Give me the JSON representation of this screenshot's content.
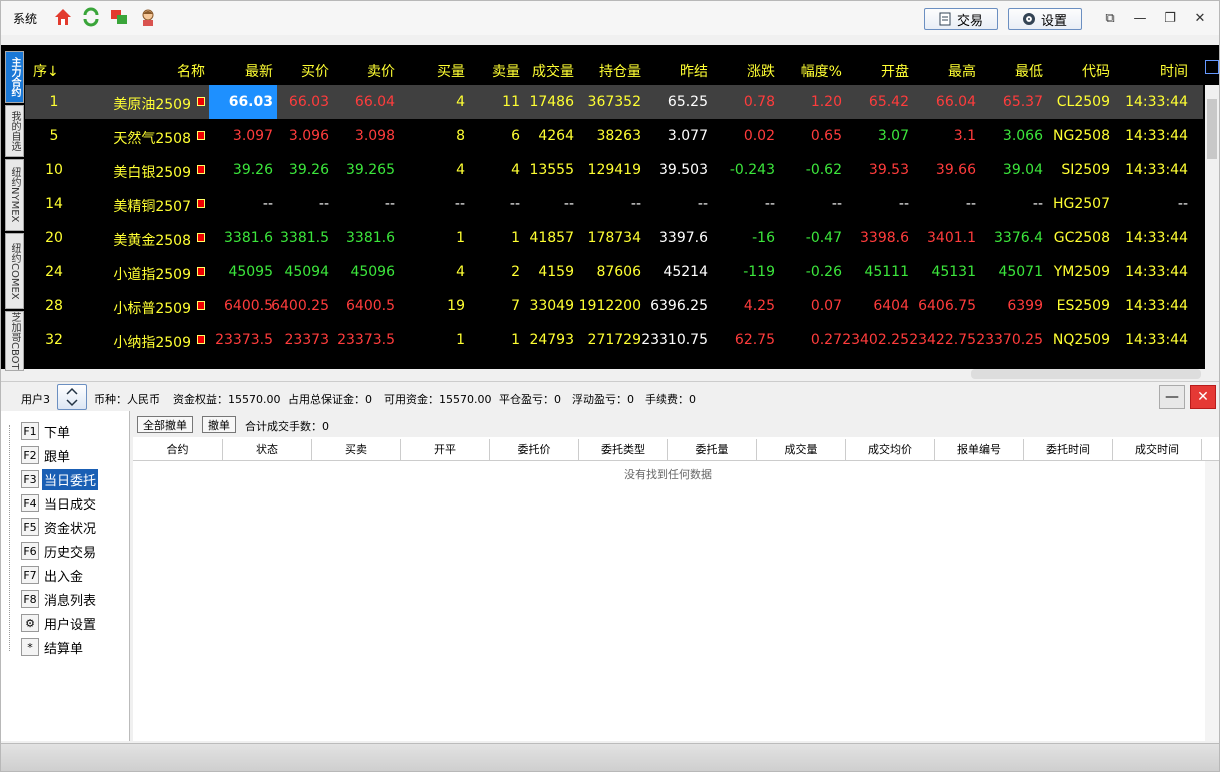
{
  "titlebar": {
    "menu_system": "系统",
    "icons": [
      "home-icon",
      "refresh-icon",
      "switch-window-icon",
      "avatar-icon"
    ],
    "trade_label": "交易",
    "settings_label": "设置"
  },
  "vtabs": [
    "主力合约",
    "我的自选",
    "纽约NYMEX",
    "纽约COMEX",
    "芝加哥CBOT"
  ],
  "quote_headers": [
    "序↓",
    "名称",
    "最新",
    "买价",
    "卖价",
    "买量",
    "卖量",
    "成交量",
    "持仓量",
    "昨结",
    "涨跌",
    "幅度%",
    "开盘",
    "最高",
    "最低",
    "代码",
    "时间"
  ],
  "quotes": [
    {
      "seq": "1",
      "name": "美原油2509",
      "last": "66.03",
      "bid": "66.03",
      "ask": "66.04",
      "bidvol": "4",
      "askvol": "11",
      "volume": "17486",
      "oi": "367352",
      "prev": "65.25",
      "chg": "0.78",
      "pct": "1.20",
      "open": "65.42",
      "high": "66.04",
      "low": "65.37",
      "code": "CL2509",
      "time": "14:33:44"
    },
    {
      "seq": "5",
      "name": "天然气2508",
      "last": "3.097",
      "bid": "3.096",
      "ask": "3.098",
      "bidvol": "8",
      "askvol": "6",
      "volume": "4264",
      "oi": "38263",
      "prev": "3.077",
      "chg": "0.02",
      "pct": "0.65",
      "open": "3.07",
      "high": "3.1",
      "low": "3.066",
      "code": "NG2508",
      "time": "14:33:44"
    },
    {
      "seq": "10",
      "name": "美白银2509",
      "last": "39.26",
      "bid": "39.26",
      "ask": "39.265",
      "bidvol": "4",
      "askvol": "4",
      "volume": "13555",
      "oi": "129419",
      "prev": "39.503",
      "chg": "-0.243",
      "pct": "-0.62",
      "open": "39.53",
      "high": "39.66",
      "low": "39.04",
      "code": "SI2509",
      "time": "14:33:44"
    },
    {
      "seq": "14",
      "name": "美精铜2507",
      "last": "--",
      "bid": "--",
      "ask": "--",
      "bidvol": "--",
      "askvol": "--",
      "volume": "--",
      "oi": "--",
      "prev": "--",
      "chg": "--",
      "pct": "--",
      "open": "--",
      "high": "--",
      "low": "--",
      "code": "HG2507",
      "time": "--"
    },
    {
      "seq": "20",
      "name": "美黄金2508",
      "last": "3381.6",
      "bid": "3381.5",
      "ask": "3381.6",
      "bidvol": "1",
      "askvol": "1",
      "volume": "41857",
      "oi": "178734",
      "prev": "3397.6",
      "chg": "-16",
      "pct": "-0.47",
      "open": "3398.6",
      "high": "3401.1",
      "low": "3376.4",
      "code": "GC2508",
      "time": "14:33:44"
    },
    {
      "seq": "24",
      "name": "小道指2509",
      "last": "45095",
      "bid": "45094",
      "ask": "45096",
      "bidvol": "4",
      "askvol": "2",
      "volume": "4159",
      "oi": "87606",
      "prev": "45214",
      "chg": "-119",
      "pct": "-0.26",
      "open": "45111",
      "high": "45131",
      "low": "45071",
      "code": "YM2509",
      "time": "14:33:44"
    },
    {
      "seq": "28",
      "name": "小标普2509",
      "last": "6400.5",
      "bid": "6400.25",
      "ask": "6400.5",
      "bidvol": "19",
      "askvol": "7",
      "volume": "33049",
      "oi": "1912200",
      "prev": "6396.25",
      "chg": "4.25",
      "pct": "0.07",
      "open": "6404",
      "high": "6406.75",
      "low": "6399",
      "code": "ES2509",
      "time": "14:33:44"
    },
    {
      "seq": "32",
      "name": "小纳指2509",
      "last": "23373.5",
      "bid": "23373",
      "ask": "23373.5",
      "bidvol": "1",
      "askvol": "1",
      "volume": "24793",
      "oi": "271729",
      "prev": "23310.75",
      "chg": "62.75",
      "pct": "0.27",
      "open": "23402.25",
      "high": "23422.75",
      "low": "23370.25",
      "code": "NQ2509",
      "time": "14:33:44"
    }
  ],
  "account": {
    "user": "用户3",
    "currency": "币种：人民币",
    "equity": "资金权益：15570.00",
    "margin": "占用总保证金：0",
    "available": "可用资金：15570.00",
    "close_pnl": "平仓盈亏：0",
    "float_pnl": "浮动盈亏：0",
    "fee": "手续费：0"
  },
  "nav": [
    {
      "key": "F1",
      "label": "下单"
    },
    {
      "key": "F2",
      "label": "跟单"
    },
    {
      "key": "F3",
      "label": "当日委托"
    },
    {
      "key": "F4",
      "label": "当日成交"
    },
    {
      "key": "F5",
      "label": "资金状况"
    },
    {
      "key": "F6",
      "label": "历史交易"
    },
    {
      "key": "F7",
      "label": "出入金"
    },
    {
      "key": "F8",
      "label": "消息列表"
    },
    {
      "key": "⚙",
      "label": "用户设置"
    },
    {
      "key": "*",
      "label": "结算单"
    }
  ],
  "orders": {
    "cancel_all": "全部撤单",
    "cancel": "撤单",
    "total": "合计成交手数：0",
    "headers": [
      "合约",
      "状态",
      "买卖",
      "开平",
      "委托价",
      "委托类型",
      "委托量",
      "成交量",
      "成交均价",
      "报单编号",
      "委托时间",
      "成交时间"
    ],
    "empty": "没有找到任何数据"
  }
}
